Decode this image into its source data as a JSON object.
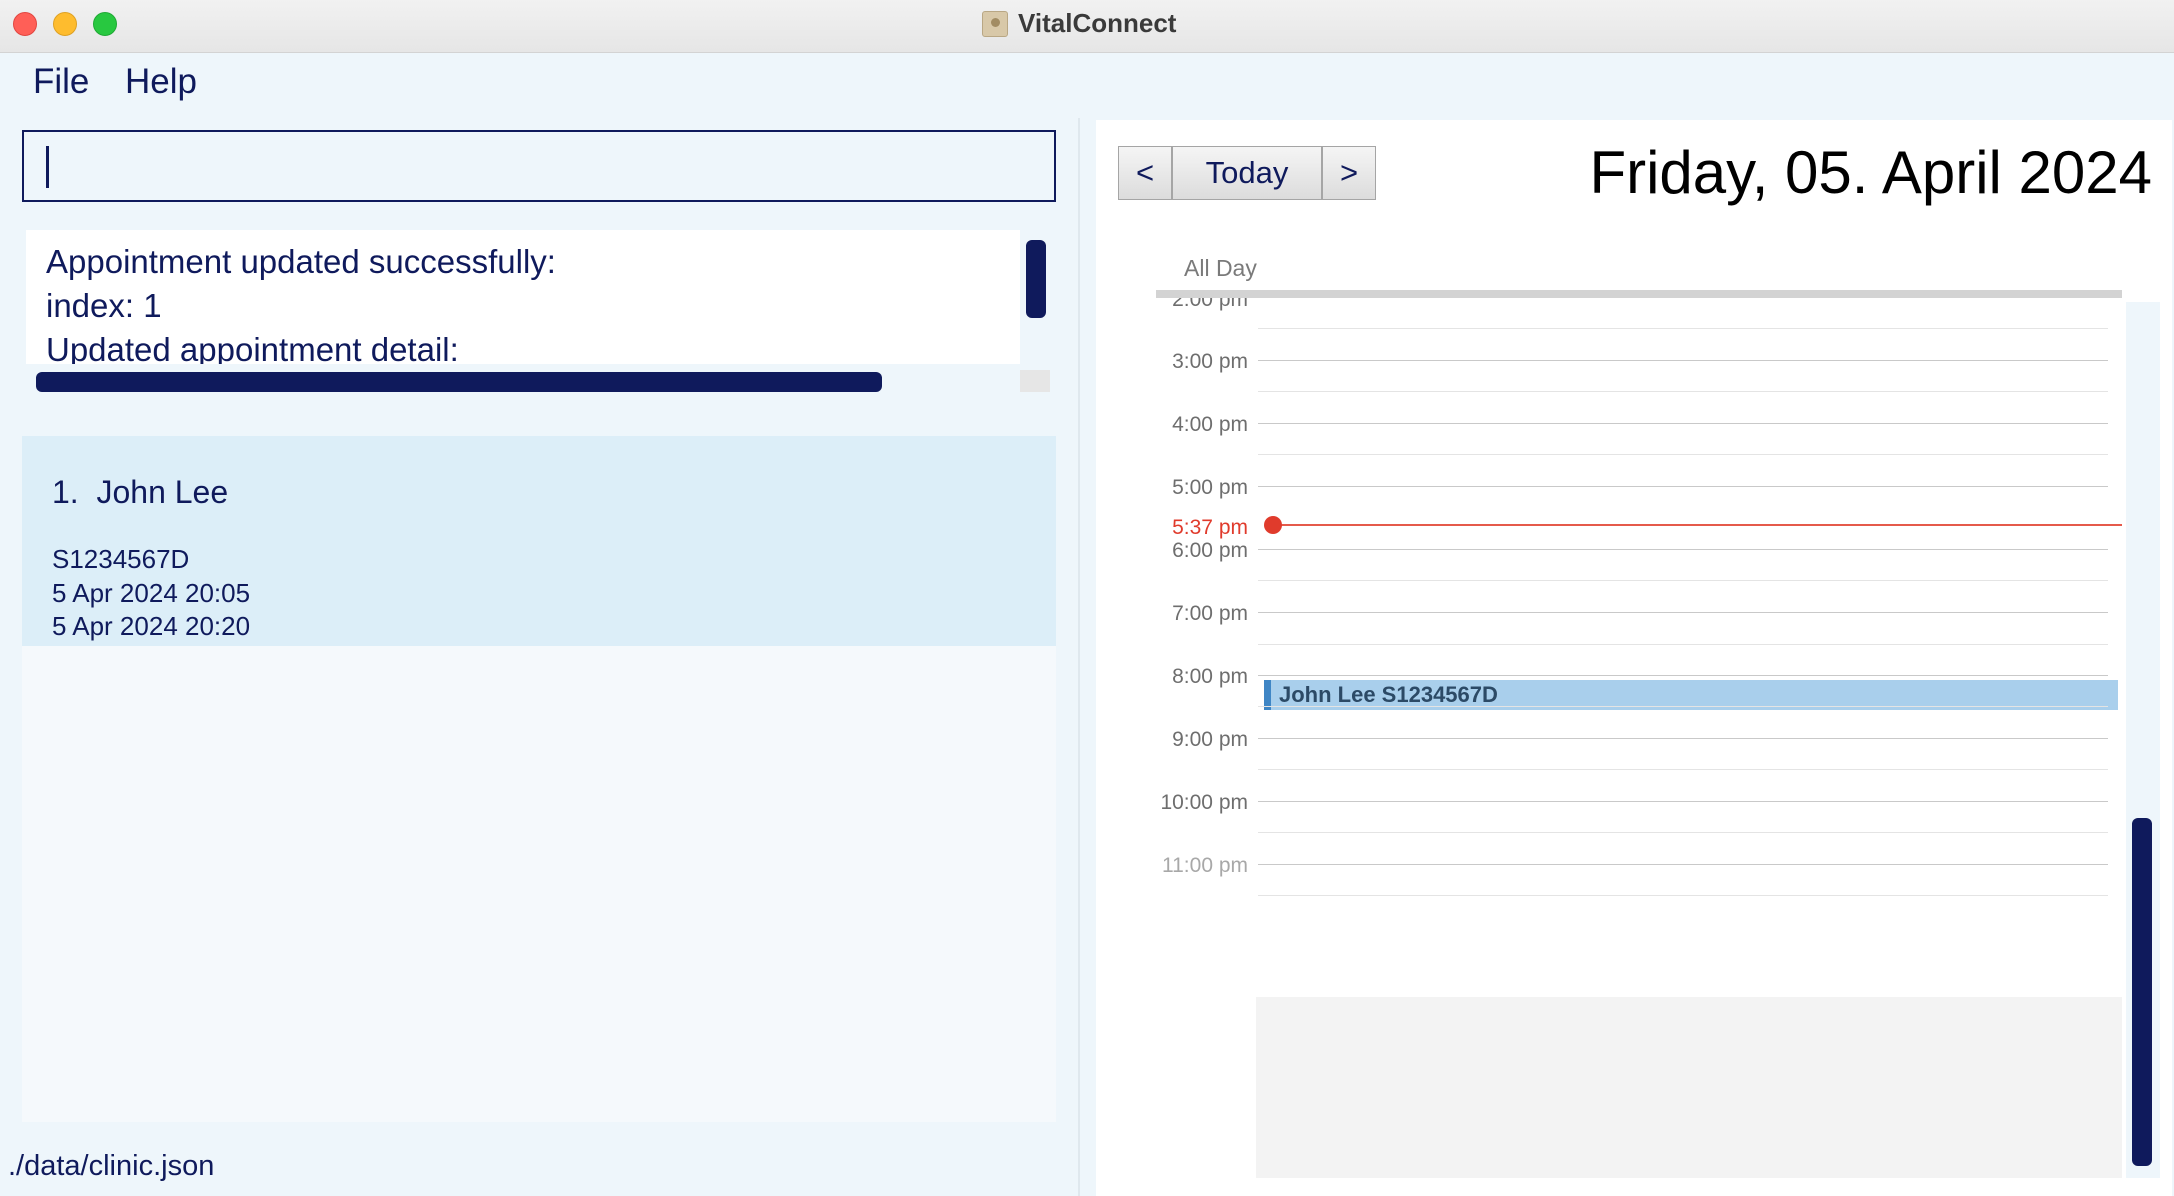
{
  "window": {
    "title": "VitalConnect"
  },
  "menu": {
    "file": "File",
    "help": "Help"
  },
  "command": {
    "value": ""
  },
  "result": {
    "text": "Appointment updated successfully:\nindex: 1\nUpdated appointment detail:"
  },
  "appointments": [
    {
      "index": "1.",
      "name": "John Lee",
      "nric": "S1234567D",
      "start": "5 Apr 2024 20:05",
      "end": "5 Apr 2024 20:20"
    }
  ],
  "status": {
    "path": "./data/clinic.json"
  },
  "calendar": {
    "prev_label": "<",
    "today_label": "Today",
    "next_label": ">",
    "date_title": "Friday, 05. April 2024",
    "all_day_label": "All Day",
    "hours": [
      "2:00 pm",
      "3:00 pm",
      "4:00 pm",
      "5:00 pm",
      "6:00 pm",
      "7:00 pm",
      "8:00 pm",
      "9:00 pm",
      "10:00 pm",
      "11:00 pm"
    ],
    "current_time": "5:37 pm",
    "event_label": "John Lee S1234567D",
    "colors": {
      "now": "#e03b2c",
      "event": "#a9cfec",
      "accent": "#0f1a5c"
    }
  }
}
